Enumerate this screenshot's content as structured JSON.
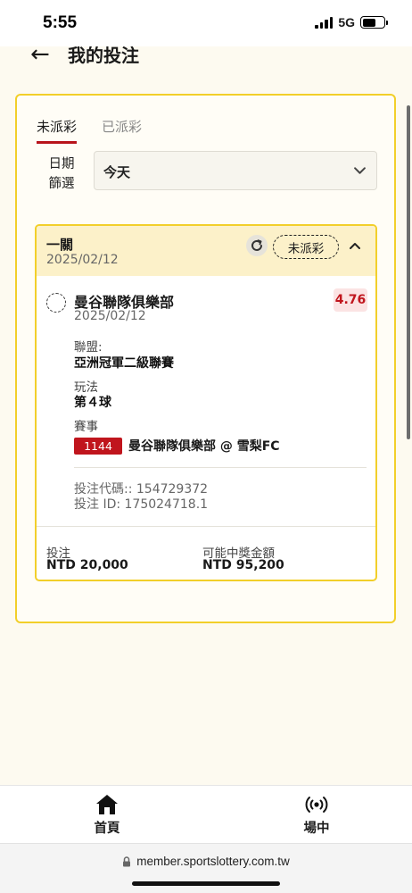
{
  "status_bar": {
    "time": "5:55",
    "network": "5G",
    "icons": [
      "signal-icon",
      "battery-icon"
    ]
  },
  "header": {
    "back_icon": "arrow-left-icon",
    "title": "我的投注"
  },
  "tabs": [
    {
      "label": "未派彩",
      "active": true
    },
    {
      "label": "已派彩",
      "active": false
    }
  ],
  "filter": {
    "label_line1": "日期",
    "label_line2": "篩選",
    "value": "今天",
    "icon": "chevron-down-icon"
  },
  "bet": {
    "type": "一關",
    "date": "2025/02/12",
    "status": "未派彩",
    "refresh_icon": "refresh-icon",
    "collapse_icon": "chevron-up-icon",
    "selection": {
      "team": "曼谷聯隊俱樂部",
      "date": "2025/02/12",
      "odds": "4.76",
      "league_label": "聯盟:",
      "league": "亞洲冠軍二級聯賽",
      "market_label": "玩法",
      "market": "第４球",
      "event_label": "賽事",
      "event_id": "1144",
      "event_name": "曼谷聯隊俱樂部 @ 雪梨FC"
    },
    "bet_code": "投注代碼:: 154729372",
    "bet_id": "投注 ID: 175024718.1",
    "stake_label": "投注",
    "stake_value": "NTD 20,000",
    "payout_label": "可能中獎金額",
    "payout_value": "NTD 95,200"
  },
  "bottom_nav": [
    {
      "label": "首頁",
      "icon": "home-icon"
    },
    {
      "label": "場中",
      "icon": "live-broadcast-icon"
    }
  ],
  "browser": {
    "url": "member.sportslottery.com.tw",
    "icon": "lock-icon"
  },
  "colors": {
    "accent_red": "#c0151d",
    "border_yellow": "#f2cf2a",
    "header_yellow": "#fcf1c9"
  }
}
